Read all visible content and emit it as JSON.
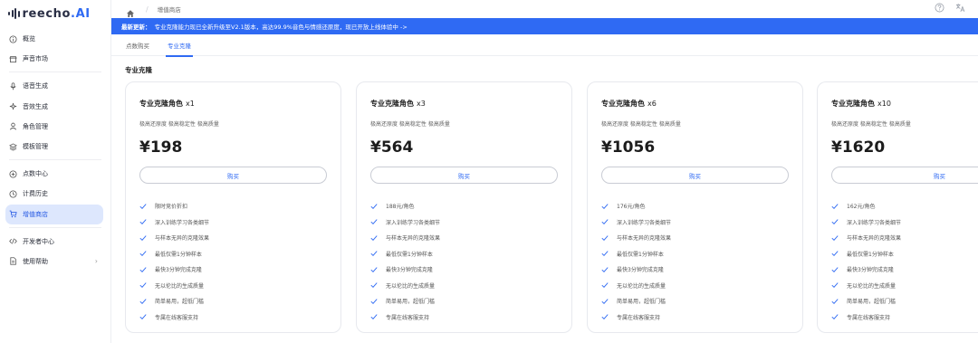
{
  "app": {
    "logo_text": "reecho",
    "logo_ai": ".AI"
  },
  "sidebar": {
    "items": [
      {
        "label": "概览",
        "icon": "info-circle-icon"
      },
      {
        "label": "声音市场",
        "icon": "store-icon"
      },
      {
        "label": "语音生成",
        "icon": "microphone-icon"
      },
      {
        "label": "音效生成",
        "icon": "sparkle-icon"
      },
      {
        "label": "角色管理",
        "icon": "user-icon"
      },
      {
        "label": "模板管理",
        "icon": "layers-icon"
      },
      {
        "label": "点数中心",
        "icon": "plus-circle-icon"
      },
      {
        "label": "计费历史",
        "icon": "history-icon"
      },
      {
        "label": "增值商店",
        "icon": "cart-icon"
      },
      {
        "label": "开发者中心",
        "icon": "code-icon"
      },
      {
        "label": "使用帮助",
        "icon": "document-icon"
      }
    ],
    "active_index": 8
  },
  "breadcrumb": {
    "current": "增值商店"
  },
  "banner": {
    "prefix": "最新更新：",
    "text": "专业克隆能力现已全新升级至V2.1版本，高达99.9%音色与情感还原度，现已开放上线体验中 ->"
  },
  "tabs": [
    {
      "label": "点数购买",
      "active": false
    },
    {
      "label": "专业克隆",
      "active": true
    }
  ],
  "section_title": "专业克隆",
  "accent_color": "#2f6af3",
  "cards": [
    {
      "title": "专业克隆角色",
      "qty": "x1",
      "subtitle": "极高还原度 极高稳定性 极高质量",
      "price": "¥198",
      "button": "购买",
      "features": [
        "限时竞价折扣",
        "深入训练学习各类细节",
        "与样本无异的克隆效果",
        "最低仅需1分钟样本",
        "最快3分钟完成克隆",
        "无以伦比的生成质量",
        "简单易用，超低门槛",
        "专属在线客服支持"
      ]
    },
    {
      "title": "专业克隆角色",
      "qty": "x3",
      "subtitle": "极高还原度 极高稳定性 极高质量",
      "price": "¥564",
      "button": "购买",
      "features": [
        "188元/角色",
        "深入训练学习各类细节",
        "与样本无异的克隆效果",
        "最低仅需1分钟样本",
        "最快3分钟完成克隆",
        "无以伦比的生成质量",
        "简单易用，超低门槛",
        "专属在线客服支持"
      ]
    },
    {
      "title": "专业克隆角色",
      "qty": "x6",
      "subtitle": "极高还原度 极高稳定性 极高质量",
      "price": "¥1056",
      "button": "购买",
      "features": [
        "176元/角色",
        "深入训练学习各类细节",
        "与样本无异的克隆效果",
        "最低仅需1分钟样本",
        "最快3分钟完成克隆",
        "无以伦比的生成质量",
        "简单易用，超低门槛",
        "专属在线客服支持"
      ]
    },
    {
      "title": "专业克隆角色",
      "qty": "x10",
      "subtitle": "极高还原度 极高稳定性 极高质量",
      "price": "¥1620",
      "button": "购买",
      "features": [
        "162元/角色",
        "深入训练学习各类细节",
        "与样本无异的克隆效果",
        "最低仅需1分钟样本",
        "最快3分钟完成克隆",
        "无以伦比的生成质量",
        "简单易用，超低门槛",
        "专属在线客服支持"
      ]
    }
  ]
}
